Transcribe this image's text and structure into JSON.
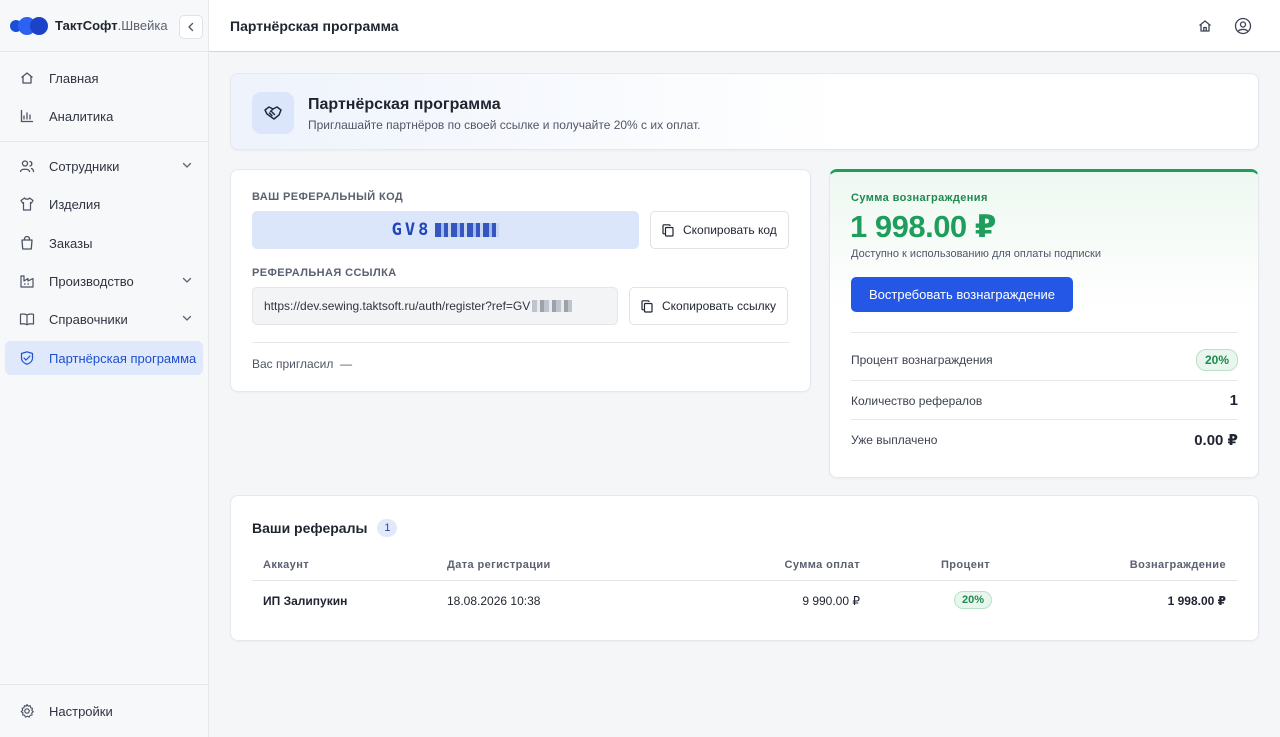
{
  "brand": {
    "name": "ТактСофт",
    "suffix": ".Швейка"
  },
  "sidebar": {
    "items": [
      {
        "label": "Главная"
      },
      {
        "label": "Аналитика"
      },
      {
        "label": "Сотрудники"
      },
      {
        "label": "Изделия"
      },
      {
        "label": "Заказы"
      },
      {
        "label": "Производство"
      },
      {
        "label": "Справочники"
      },
      {
        "label": "Партнёрская программа"
      }
    ],
    "settings": "Настройки"
  },
  "header": {
    "title": "Партнёрская программа"
  },
  "hero": {
    "title": "Партнёрская программа",
    "subtitle": "Приглашайте партнёров по своей ссылке и получайте 20% с их оплат."
  },
  "referral": {
    "code_label": "Ваш реферальный код",
    "code_prefix": "GV8",
    "copy_code": "Скопировать код",
    "link_label": "Реферальная ссылка",
    "link_prefix": "https://dev.sewing.taktsoft.ru/auth/register?ref=GV",
    "copy_link": "Скопировать ссылку",
    "invited_by": "Вас пригласил",
    "invited_value": "—"
  },
  "reward": {
    "caption": "Сумма вознаграждения",
    "amount": "1 998.00 ₽",
    "note": "Доступно к использованию для оплаты подписки",
    "button": "Востребовать вознаграждение",
    "stats": [
      {
        "label": "Процент вознаграждения",
        "value": "20%"
      },
      {
        "label": "Количество рефералов",
        "value": "1"
      },
      {
        "label": "Уже выплачено",
        "value": "0.00 ₽"
      }
    ]
  },
  "referrals_table": {
    "title": "Ваши рефералы",
    "count": "1",
    "columns": [
      "Аккаунт",
      "Дата регистрации",
      "Сумма оплат",
      "Процент",
      "Вознаграждение"
    ],
    "rows": [
      {
        "account": "ИП Залипукин",
        "date": "18.08.2026 10:38",
        "sum": "9 990.00 ₽",
        "percent": "20%",
        "reward": "1 998.00 ₽"
      }
    ]
  },
  "colors": {
    "accent": "#2457e6",
    "success": "#1e9e5a",
    "active_bg": "#dfe9fb"
  }
}
